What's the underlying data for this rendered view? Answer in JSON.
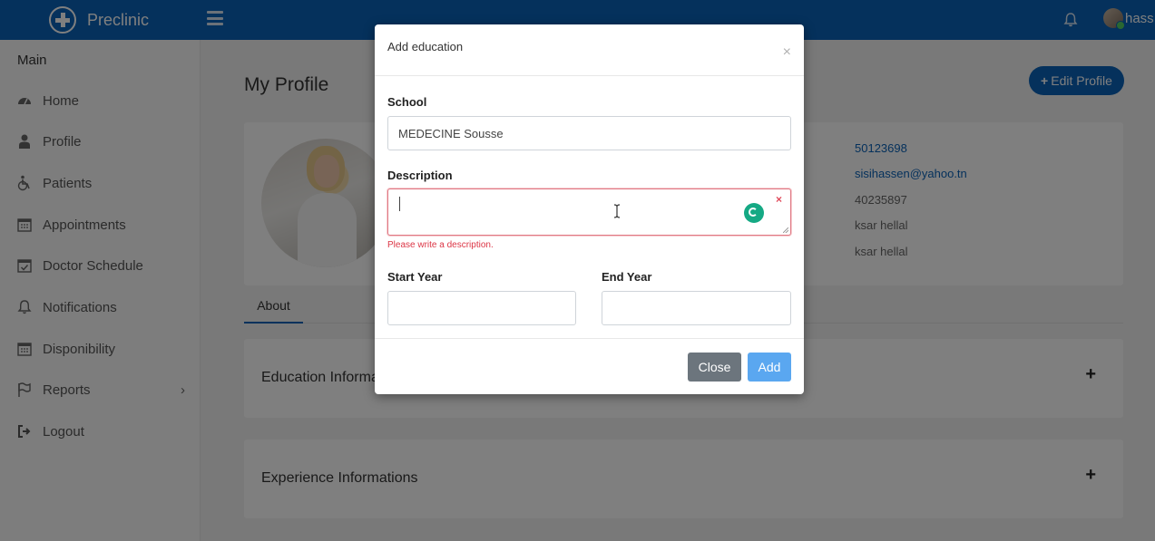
{
  "app": {
    "brand": "Preclinic",
    "user_name": "hass"
  },
  "sidebar": {
    "section": "Main",
    "items": [
      {
        "label": "Home",
        "icon": "dashboard-icon"
      },
      {
        "label": "Profile",
        "icon": "user-md-icon"
      },
      {
        "label": "Patients",
        "icon": "wheelchair-icon"
      },
      {
        "label": "Appointments",
        "icon": "calendar-icon"
      },
      {
        "label": "Doctor Schedule",
        "icon": "calendar-check-icon"
      },
      {
        "label": "Notifications",
        "icon": "bell-icon"
      },
      {
        "label": "Disponibility",
        "icon": "calendar-icon"
      },
      {
        "label": "Reports",
        "icon": "flag-icon",
        "chevron": "›"
      },
      {
        "label": "Logout",
        "icon": "sign-out-icon"
      }
    ]
  },
  "page": {
    "title": "My Profile",
    "edit_button": "Edit Profile",
    "info_values": [
      "50123698",
      "sisihassen@yahoo.tn",
      "40235897",
      "ksar hellal",
      "ksar hellal"
    ],
    "tab_about": "About",
    "education_title": "Education Informa",
    "experience_title": "Experience Informations",
    "plus": "+"
  },
  "modal": {
    "title": "Add education",
    "close_symbol": "×",
    "school_label": "School",
    "school_value": "MEDECINE Sousse",
    "description_label": "Description",
    "description_value": "",
    "description_clear": "×",
    "description_error": "Please write a description.",
    "start_year_label": "Start Year",
    "start_year_value": "",
    "end_year_label": "End Year",
    "end_year_value": "",
    "close_button": "Close",
    "add_button": "Add"
  },
  "colors": {
    "header": "#0a62b8",
    "primary_button": "#5aa7f0",
    "secondary_button": "#6c757d",
    "error": "#dc3545",
    "grammarly": "#15a984"
  }
}
